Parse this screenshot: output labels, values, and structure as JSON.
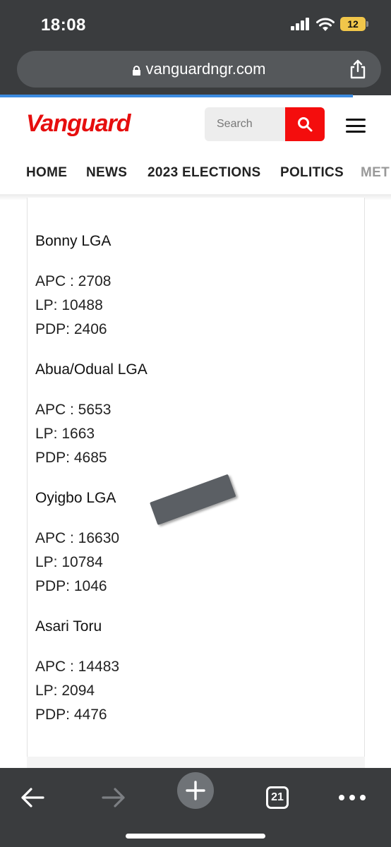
{
  "status_bar": {
    "time": "18:08",
    "battery": "12"
  },
  "browser": {
    "url": "vanguardngr.com",
    "tab_count": "21"
  },
  "site": {
    "logo": "Vanguard",
    "search_placeholder": "Search",
    "nav": [
      "HOME",
      "NEWS",
      "2023 ELECTIONS",
      "POLITICS",
      "MET"
    ]
  },
  "results": [
    {
      "name": "Bonny LGA",
      "lines": [
        "APC : 2708",
        "LP: 10488",
        "PDP: 2406"
      ]
    },
    {
      "name": "Abua/Odual LGA",
      "lines": [
        "APC : 5653",
        "LP: 1663",
        "PDP: 4685"
      ]
    },
    {
      "name": "Oyigbo LGA",
      "lines": [
        "APC : 16630",
        "LP: 10784",
        "PDP: 1046"
      ]
    },
    {
      "name": "Asari Toru",
      "lines": [
        "APC : 14483",
        "LP: 2094",
        "PDP: 4476"
      ]
    }
  ],
  "colors": {
    "brand_red": "#e60e0e",
    "search_button": "#f40d0d",
    "chrome": "#3a3c3e",
    "progress": "#3c8be0"
  },
  "icons": [
    "lock-icon",
    "share-icon",
    "search-icon",
    "menu-icon",
    "back-arrow-icon",
    "forward-arrow-icon",
    "plus-icon",
    "tabs-icon",
    "more-icon",
    "signal-icon",
    "wifi-icon",
    "battery-icon"
  ]
}
